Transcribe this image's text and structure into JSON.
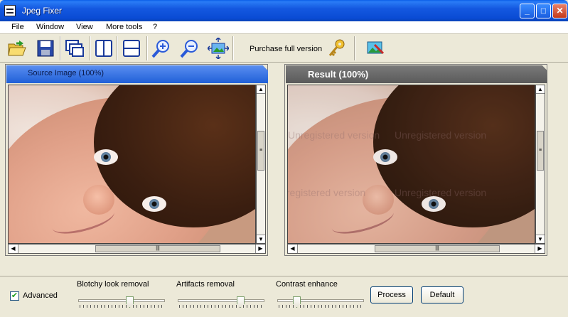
{
  "window": {
    "title": "Jpeg Fixer",
    "min_label": "_",
    "max_label": "□",
    "close_label": "✕"
  },
  "menu": [
    "File",
    "Window",
    "View",
    "More tools",
    "?"
  ],
  "toolbar": {
    "purchase_label": "Purchase full version",
    "icons": [
      "open-folder-icon",
      "save-icon",
      "cascade-windows-icon",
      "tile-vertical-icon",
      "tile-horizontal-icon",
      "zoom-in-icon",
      "zoom-out-icon",
      "fit-to-window-icon",
      "key-icon",
      "image-edit-icon"
    ]
  },
  "source_panel": {
    "title": "Source Image (100%)"
  },
  "result_panel": {
    "title": "Result (100%)",
    "watermarks": [
      "Unregistered version",
      "Unregistered version",
      "Unregistered version",
      "Unregistered version"
    ]
  },
  "scrollbar": {
    "up": "▲",
    "down": "▼",
    "left": "◀",
    "right": "▶",
    "grip": "≡",
    "hgrip": "|||"
  },
  "controls": {
    "advanced_label": "Advanced",
    "advanced_checked": true,
    "check_mark": "✔",
    "sliders": [
      {
        "label": "Blotchy look removal",
        "value": 0.6
      },
      {
        "label": "Artifacts removal",
        "value": 0.75
      },
      {
        "label": "Contrast enhance",
        "value": 0.2
      }
    ],
    "process_label": "Process",
    "default_label": "Default"
  }
}
